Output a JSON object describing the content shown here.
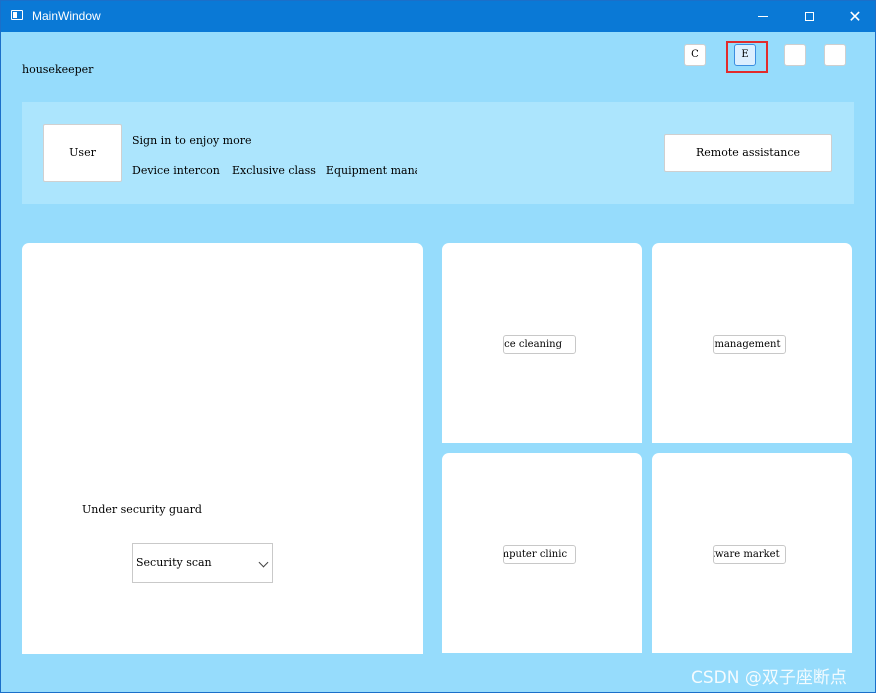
{
  "window": {
    "title": "MainWindow"
  },
  "app": {
    "name": "housekeeper"
  },
  "toolbar": {
    "btn1": "C",
    "btn2": "E",
    "btn3": "",
    "btn4": ""
  },
  "user_panel": {
    "user_label": "User",
    "sign_in": "Sign in to enjoy more",
    "features": [
      "Device intercon",
      "Exclusive class",
      "Equipment manag"
    ],
    "remote_label": "Remote assistance"
  },
  "security": {
    "status": "Under security guard",
    "scan_value": "Security scan"
  },
  "tiles": [
    {
      "label": "Space cleaning"
    },
    {
      "label": "Authority management"
    },
    {
      "label": "Computer clinic"
    },
    {
      "label": "Software market"
    }
  ],
  "watermark": "CSDN @双子座断点"
}
